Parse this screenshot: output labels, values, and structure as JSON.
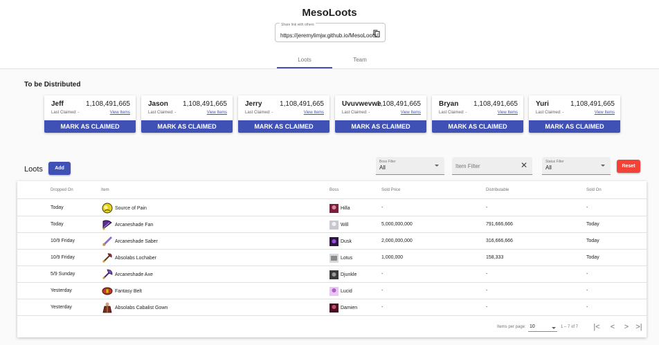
{
  "app": {
    "title": "MesoLoots"
  },
  "share": {
    "label": "Share link with others",
    "url": "https://jeremylimjw.github.io/MesoLoots/"
  },
  "tabs": [
    {
      "label": "Loots",
      "active": true
    },
    {
      "label": "Team",
      "active": false
    }
  ],
  "distribution": {
    "title": "To be Distributed",
    "claimed_label": "Last Claimed: -",
    "view_label": "View Items",
    "button_label": "MARK AS CLAIMED",
    "members": [
      {
        "name": "Jeff",
        "amount": "1,108,491,665"
      },
      {
        "name": "Jason",
        "amount": "1,108,491,665"
      },
      {
        "name": "Jerry",
        "amount": "1,108,491,665"
      },
      {
        "name": "Uvuvwevwe",
        "amount": "1,108,491,665"
      },
      {
        "name": "Bryan",
        "amount": "1,108,491,665"
      },
      {
        "name": "Yuri",
        "amount": "1,108,491,665"
      }
    ]
  },
  "loots": {
    "title": "Loots",
    "add_label": "Add",
    "boss_filter": {
      "label": "Boss Filter",
      "value": "All"
    },
    "item_filter": {
      "placeholder": "Item Filter"
    },
    "status_filter": {
      "label": "Status Filter",
      "value": "All"
    },
    "reset_label": "Reset",
    "columns": {
      "dropped": "Dropped On",
      "item": "Item",
      "boss": "Boss",
      "sold_price": "Sold Price",
      "distributable": "Distributable",
      "sold_on": "Sold On"
    },
    "rows": [
      {
        "dropped": "Today",
        "item": "Source of Pain",
        "item_icon": "yellow-orb-icon",
        "boss": "Hilla",
        "sold_price": "-",
        "distributable": "-",
        "sold_on": "-"
      },
      {
        "dropped": "Today",
        "item": "Arcaneshade Fan",
        "item_icon": "purple-fan-icon",
        "boss": "Will",
        "sold_price": "5,000,000,000",
        "distributable": "791,666,666",
        "sold_on": "Today"
      },
      {
        "dropped": "10/9 Friday",
        "item": "Arcaneshade Saber",
        "item_icon": "saber-icon",
        "boss": "Dusk",
        "sold_price": "2,000,000,000",
        "distributable": "316,666,666",
        "sold_on": "Today"
      },
      {
        "dropped": "10/9 Friday",
        "item": "Absolabs Lochaber",
        "item_icon": "lochaber-icon",
        "boss": "Lotus",
        "sold_price": "1,000,000",
        "distributable": "158,333",
        "sold_on": "Today"
      },
      {
        "dropped": "5/9 Sunday",
        "item": "Arcaneshade Axe",
        "item_icon": "axe-icon",
        "boss": "Djunkle",
        "sold_price": "-",
        "distributable": "-",
        "sold_on": "-"
      },
      {
        "dropped": "Yesterday",
        "item": "Fantasy Belt",
        "item_icon": "belt-icon",
        "boss": "Lucid",
        "sold_price": "-",
        "distributable": "-",
        "sold_on": "-"
      },
      {
        "dropped": "Yesterday",
        "item": "Absolabs Cabalist Gown",
        "item_icon": "gown-icon",
        "boss": "Damien",
        "sold_price": "-",
        "distributable": "-",
        "sold_on": "-"
      }
    ]
  },
  "paginator": {
    "label": "Items per page:",
    "page_size": "10",
    "range": "1 – 7 of 7"
  },
  "colors": {
    "primary": "#3f51b5",
    "warn": "#f44336",
    "background": "#fafafa"
  }
}
